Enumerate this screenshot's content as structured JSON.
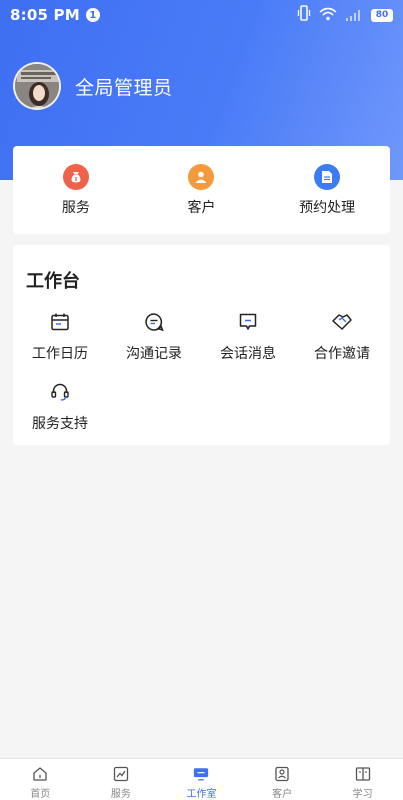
{
  "status_bar": {
    "time": "8:05 PM",
    "notification_count": "1",
    "battery": "80",
    "icons": [
      "vibrate-icon",
      "wifi-icon",
      "signal-icon",
      "battery-icon"
    ]
  },
  "profile": {
    "name": "全局管理员"
  },
  "quick_actions": [
    {
      "label": "服务",
      "icon": "money-bag-icon",
      "color": "#f0624a"
    },
    {
      "label": "客户",
      "icon": "person-icon",
      "color": "#f49a3c"
    },
    {
      "label": "预约处理",
      "icon": "document-icon",
      "color": "#3c7cf0"
    }
  ],
  "workbench": {
    "title": "工作台",
    "items": [
      {
        "label": "工作日历",
        "icon": "calendar-icon"
      },
      {
        "label": "沟通记录",
        "icon": "chat-bubble-icon"
      },
      {
        "label": "会话消息",
        "icon": "message-icon"
      },
      {
        "label": "合作邀请",
        "icon": "handshake-icon"
      },
      {
        "label": "服务支持",
        "icon": "headset-icon"
      }
    ]
  },
  "bottom_nav": {
    "items": [
      {
        "label": "首页",
        "icon": "home-icon",
        "active": false
      },
      {
        "label": "服务",
        "icon": "chart-icon",
        "active": false
      },
      {
        "label": "工作室",
        "icon": "monitor-icon",
        "active": true
      },
      {
        "label": "客户",
        "icon": "contact-card-icon",
        "active": false
      },
      {
        "label": "学习",
        "icon": "book-icon",
        "active": false
      }
    ],
    "active_color": "#3f6ff2",
    "inactive_color": "#888888"
  }
}
